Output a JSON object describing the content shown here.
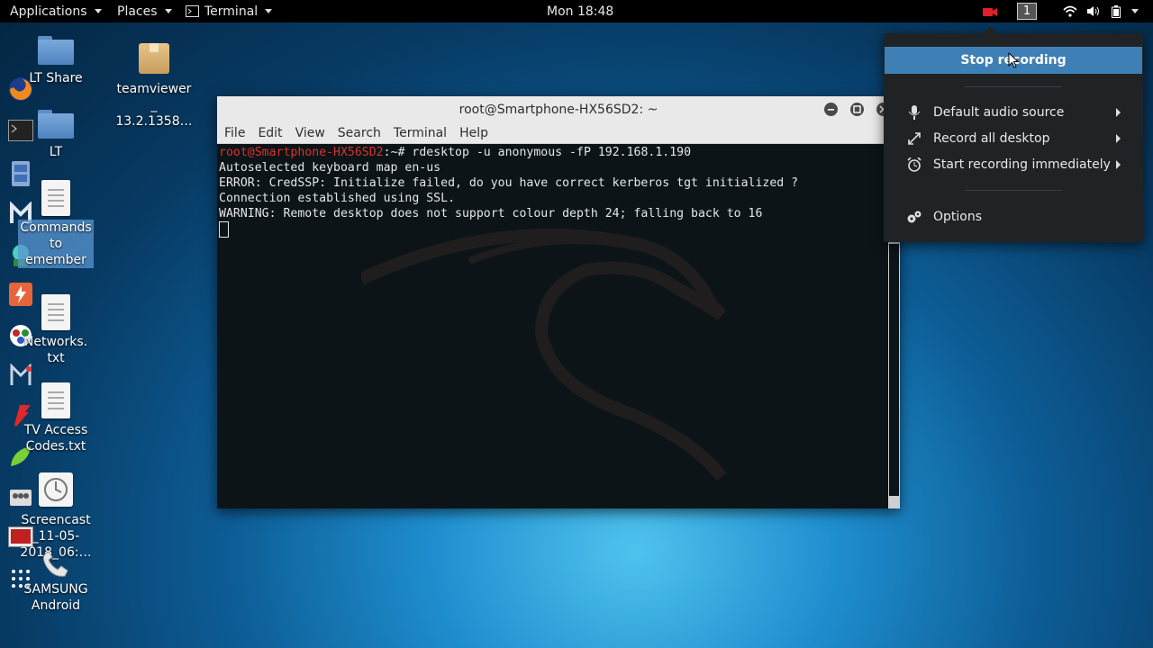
{
  "topbar": {
    "applications": "Applications",
    "places": "Places",
    "terminal": "Terminal",
    "clock": "Mon 18:48",
    "workspace": "1",
    "recording_color": "#e0202a"
  },
  "desktop_icons": [
    {
      "label": "LT Share"
    },
    {
      "label": "teamviewer\n_\n13.2.1358…"
    },
    {
      "label": "LT"
    },
    {
      "label": "Commands\nto\nemember"
    },
    {
      "label": "Networks.\ntxt"
    },
    {
      "label": "TV Access\nCodes.txt"
    },
    {
      "label": "Screencast\n_11-05-\n2018_06:…"
    },
    {
      "label": "SAMSUNG\nAndroid"
    }
  ],
  "terminal": {
    "title": "root@Smartphone-HX56SD2: ~",
    "menu": [
      "File",
      "Edit",
      "View",
      "Search",
      "Terminal",
      "Help"
    ],
    "prompt_user": "root@Smartphone-HX56SD2",
    "prompt_rest": ":~# ",
    "command": "rdesktop -u anonymous -fP 192.168.1.190",
    "output": [
      "Autoselected keyboard map en-us",
      "ERROR: CredSSP: Initialize failed, do you have correct kerberos tgt initialized ?",
      "Connection established using SSL.",
      "WARNING: Remote desktop does not support colour depth 24; falling back to 16"
    ]
  },
  "recorder_popup": {
    "stop": "Stop recording",
    "items": [
      {
        "label": "Default audio source",
        "icon": "microphone-icon"
      },
      {
        "label": "Record all desktop",
        "icon": "expand-icon"
      },
      {
        "label": "Start recording immediately",
        "icon": "alarm-clock-icon"
      }
    ],
    "options": "Options"
  }
}
